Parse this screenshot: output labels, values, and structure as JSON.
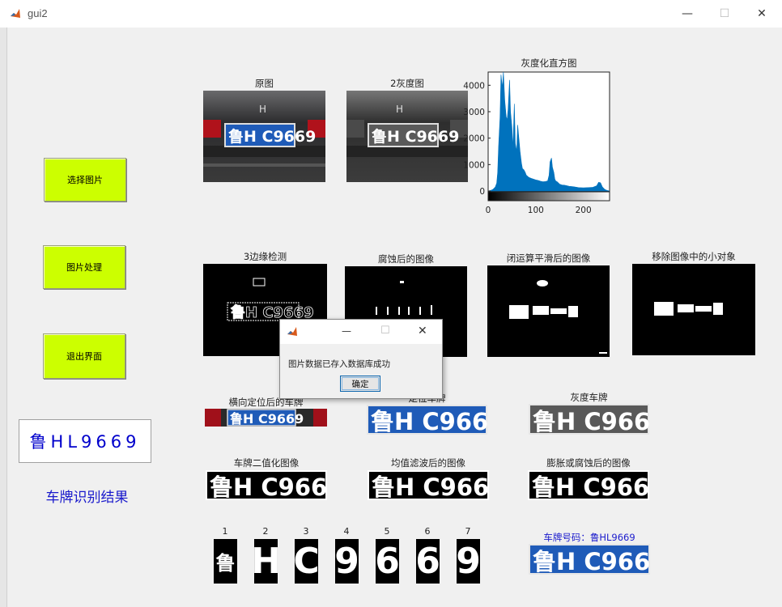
{
  "window": {
    "title": "gui2",
    "min": "—",
    "max": "☐",
    "close": "✕"
  },
  "buttons": {
    "select": "选择图片",
    "process": "图片处理",
    "exit": "退出界面"
  },
  "result": {
    "plate": "鲁HL9669",
    "label": "车牌识别结果"
  },
  "axes": {
    "original": "原图",
    "gray": "2灰度图",
    "hist": "灰度化直方图",
    "edge": "3边缘检测",
    "eroded": "腐蚀后的图像",
    "closed": "闭运算平滑后的图像",
    "removed": "移除图像中的小对象",
    "horiz": "横向定位后的车牌",
    "located": "定位车牌",
    "gray_plate": "灰度车牌",
    "binary": "车牌二值化图像",
    "median": "均值滤波后的图像",
    "dilate": "膨胀或腐蚀后的图像",
    "plate_number": "车牌号码：鲁HL9669"
  },
  "plate_image_text": "鲁H C9669",
  "chars": [
    {
      "num": "1",
      "glyph": "鲁"
    },
    {
      "num": "2",
      "glyph": "H"
    },
    {
      "num": "3",
      "glyph": "C"
    },
    {
      "num": "4",
      "glyph": "9"
    },
    {
      "num": "5",
      "glyph": "6"
    },
    {
      "num": "6",
      "glyph": "6"
    },
    {
      "num": "7",
      "glyph": "9"
    }
  ],
  "chart_data": {
    "type": "area",
    "title": "灰度化直方图",
    "xlim": [
      0,
      255
    ],
    "ylim": [
      0,
      4500
    ],
    "xticks": [
      0,
      100,
      200
    ],
    "yticks": [
      0,
      1000,
      2000,
      3000,
      4000
    ],
    "ytick_labels": [
      "0",
      "1000",
      "2000",
      "3000",
      "4000"
    ],
    "color": "#0072bd",
    "x": [
      0,
      5,
      10,
      15,
      18,
      20,
      22,
      25,
      27,
      30,
      32,
      35,
      38,
      40,
      42,
      45,
      47,
      50,
      52,
      55,
      57,
      60,
      62,
      65,
      67,
      70,
      72,
      75,
      78,
      80,
      85,
      90,
      95,
      100,
      105,
      110,
      115,
      120,
      125,
      128,
      130,
      133,
      135,
      138,
      140,
      142,
      145,
      150,
      155,
      160,
      165,
      170,
      175,
      180,
      190,
      200,
      210,
      220,
      228,
      232,
      236,
      240,
      245,
      250,
      255
    ],
    "values": [
      0,
      20,
      60,
      150,
      300,
      700,
      1700,
      2800,
      4400,
      3900,
      4500,
      3400,
      2800,
      2700,
      3100,
      4200,
      3000,
      2400,
      1600,
      3300,
      1800,
      1500,
      2500,
      1900,
      1500,
      1050,
      850,
      800,
      700,
      600,
      520,
      480,
      450,
      420,
      400,
      370,
      350,
      360,
      380,
      600,
      1100,
      1250,
      900,
      700,
      450,
      380,
      350,
      260,
      230,
      220,
      200,
      180,
      170,
      160,
      130,
      120,
      130,
      140,
      200,
      330,
      310,
      150,
      60,
      20,
      0
    ],
    "gradient_bar": {
      "from": "#000000",
      "to": "#ffffff"
    }
  },
  "dialog": {
    "message": "图片数据已存入数据库成功",
    "ok": "确定",
    "min": "—",
    "max": "☐",
    "close": "✕"
  },
  "colors": {
    "button": "#ccff00",
    "result_text": "#0000cc",
    "plate_blue": "#1f5bb8",
    "hist_bar": "#0072bd"
  }
}
